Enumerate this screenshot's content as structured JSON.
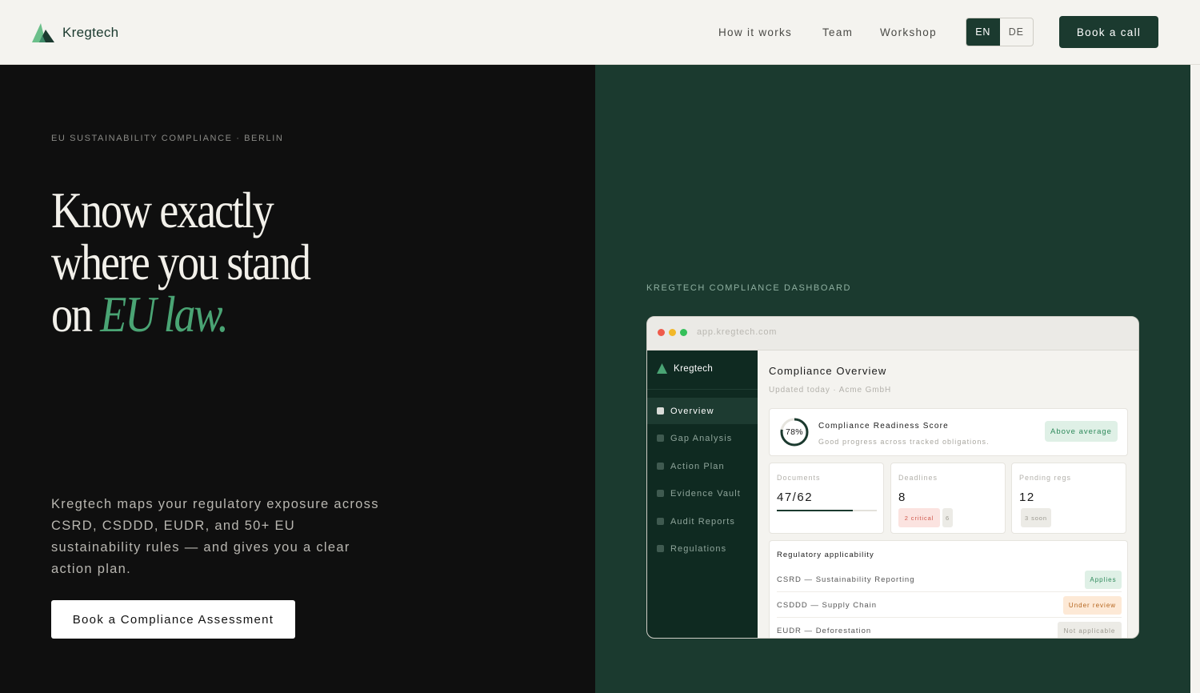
{
  "header": {
    "brand": "Kregtech",
    "nav": [
      "How it works",
      "Team",
      "Workshop"
    ],
    "lang_active": "EN",
    "lang_inactive": "DE",
    "cta": "Book a call"
  },
  "hero": {
    "eyebrow": "EU SUSTAINABILITY COMPLIANCE · BERLIN",
    "headline_line1": "Know exactly",
    "headline_line2": "where you stand",
    "headline_line3_prefix": "on",
    "headline_line3_accent": "EU law.",
    "description": "Kregtech maps your regulatory exposure across CSRD, CSDDD, EUDR, and 50+ EU sustainability rules — and gives you a clear action plan.",
    "cta": "Book a Compliance Assessment"
  },
  "dashboard": {
    "label": "KREGTECH COMPLIANCE DASHBOARD",
    "url": "app.kregtech.com",
    "sidebar": {
      "brand": "Kregtech",
      "items": [
        "Overview",
        "Gap Analysis",
        "Action Plan",
        "Evidence Vault",
        "Audit Reports",
        "Regulations"
      ],
      "active_index": 0
    },
    "title": "Compliance Overview",
    "subtitle": "Updated today · Acme GmbH",
    "score": {
      "value_label": "78%",
      "value": 78,
      "title": "Compliance Readiness Score",
      "subtitle": "Good progress across tracked obligations.",
      "badge": "Above average"
    },
    "stats": [
      {
        "label": "Documents",
        "value": "47/62",
        "progress": 0.758
      },
      {
        "label": "Deadlines",
        "value": "8",
        "tag_critical": "2 critical",
        "tag_other": "6"
      },
      {
        "label": "Pending regs",
        "value": "12",
        "tag": "3 soon"
      }
    ],
    "regulatory": {
      "title": "Regulatory applicability",
      "rows": [
        {
          "name": "CSRD — Sustainability Reporting",
          "status": "Applies"
        },
        {
          "name": "CSDDD — Supply Chain",
          "status": "Under review"
        },
        {
          "name": "EUDR — Deforestation",
          "status": "Not applicable"
        }
      ]
    }
  },
  "colors": {
    "brand_dark": "#1b3a2f",
    "accent_green": "#4aa474",
    "hero_bg": "#0f0f0f",
    "header_bg": "#f4f3ef"
  }
}
